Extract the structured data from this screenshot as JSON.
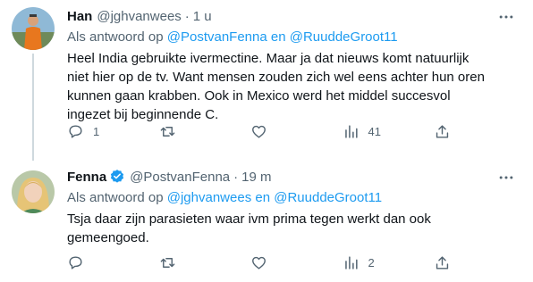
{
  "tweets": [
    {
      "name": "Han",
      "handle": "@jghvanwees",
      "time": "1 u",
      "reply_prefix": "Als antwoord op",
      "reply_mention_1": "@PostvanFenna",
      "reply_and": "en",
      "reply_mention_2": "@RuuddeGroot11",
      "text": "Heel India gebruikte ivermectine. Maar ja dat nieuws komt natuurlijk niet hier op de tv. Want mensen zouden zich wel eens achter hun oren kunnen gaan krabben. Ook in Mexico werd het middel succesvol ingezet bij beginnende C.",
      "reply_count": "1",
      "retweet_count": "",
      "like_count": "",
      "view_count": "41",
      "avatar": "avatar-orange-jacket"
    },
    {
      "name": "Fenna",
      "handle": "@PostvanFenna",
      "time": "19 m",
      "verified": true,
      "reply_prefix": "Als antwoord op",
      "reply_mention_1": "@jghvanwees",
      "reply_and": "en",
      "reply_mention_2": "@RuuddeGroot11",
      "text": "Tsja daar zijn parasieten waar ivm prima tegen werkt dan ook gemeengoed.",
      "reply_count": "",
      "retweet_count": "",
      "like_count": "",
      "view_count": "2",
      "avatar": "avatar-blonde-woman"
    }
  ],
  "colors": {
    "text": "#0f1419",
    "secondary": "#536471",
    "link": "#1d9bf0",
    "thread_line": "#cfd9de"
  },
  "icons": [
    "more-icon",
    "reply-icon",
    "retweet-icon",
    "like-icon",
    "views-icon",
    "share-icon",
    "verified-icon"
  ]
}
